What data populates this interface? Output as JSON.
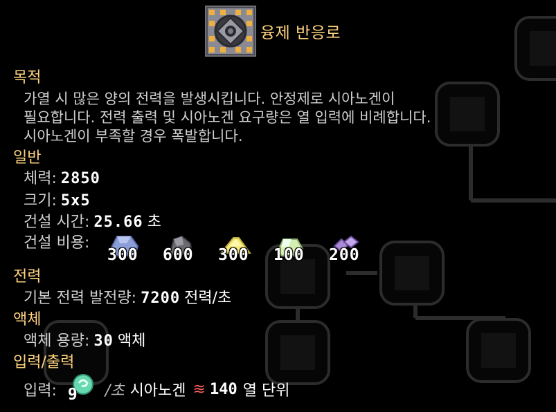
{
  "block": {
    "name": "융제 반응로",
    "icon": "impact-reactor-icon"
  },
  "sections": {
    "purpose": "목적",
    "general": "일반",
    "power": "전력",
    "liquid": "액체",
    "io": "입력/출력"
  },
  "description": [
    "가열 시 많은 양의 전력을 발생시킵니다. 안정제로 시아노겐이",
    "필요합니다. 전력 출력 및 시아노겐 요구량은 열 입력에 비례합니다.",
    "시아노겐이 부족할 경우 폭발합니다."
  ],
  "stats": {
    "health_label": "체력:",
    "health_value": "2850",
    "size_label": "크기:",
    "size_value": "5x5",
    "build_time_label": "건설 시간:",
    "build_time_value": "25.66",
    "build_time_unit": "초",
    "build_cost_label": "건설 비용:"
  },
  "build_cost": [
    {
      "icon": "lead-icon",
      "amount": "300",
      "color": "#8c9ed9"
    },
    {
      "icon": "silicon-icon",
      "amount": "600",
      "color": "#7a7a80"
    },
    {
      "icon": "surge-alloy-icon",
      "amount": "300",
      "color": "#f3e979"
    },
    {
      "icon": "metaglass-icon",
      "amount": "100",
      "color": "#d4f0b0"
    },
    {
      "icon": "plastanium-icon",
      "amount": "200",
      "color": "#a98ad6"
    }
  ],
  "power": {
    "label": "기본 전력 발전량:",
    "value": "7200",
    "unit": "전력/초"
  },
  "liquid": {
    "label": "액체 용량:",
    "value": "30",
    "unit": "액체"
  },
  "io": {
    "input_label": "입력:",
    "input_amount": "9",
    "input_icon": "cyanogen-icon",
    "per_second": "/초",
    "liquid_name": "시아노겐",
    "heat_icon": "heat-icon",
    "heat_value": "140",
    "heat_unit": "열 단위"
  },
  "colors": {
    "accent": "#ffd37f",
    "background": "#000000",
    "text": "#cfcfcf"
  }
}
